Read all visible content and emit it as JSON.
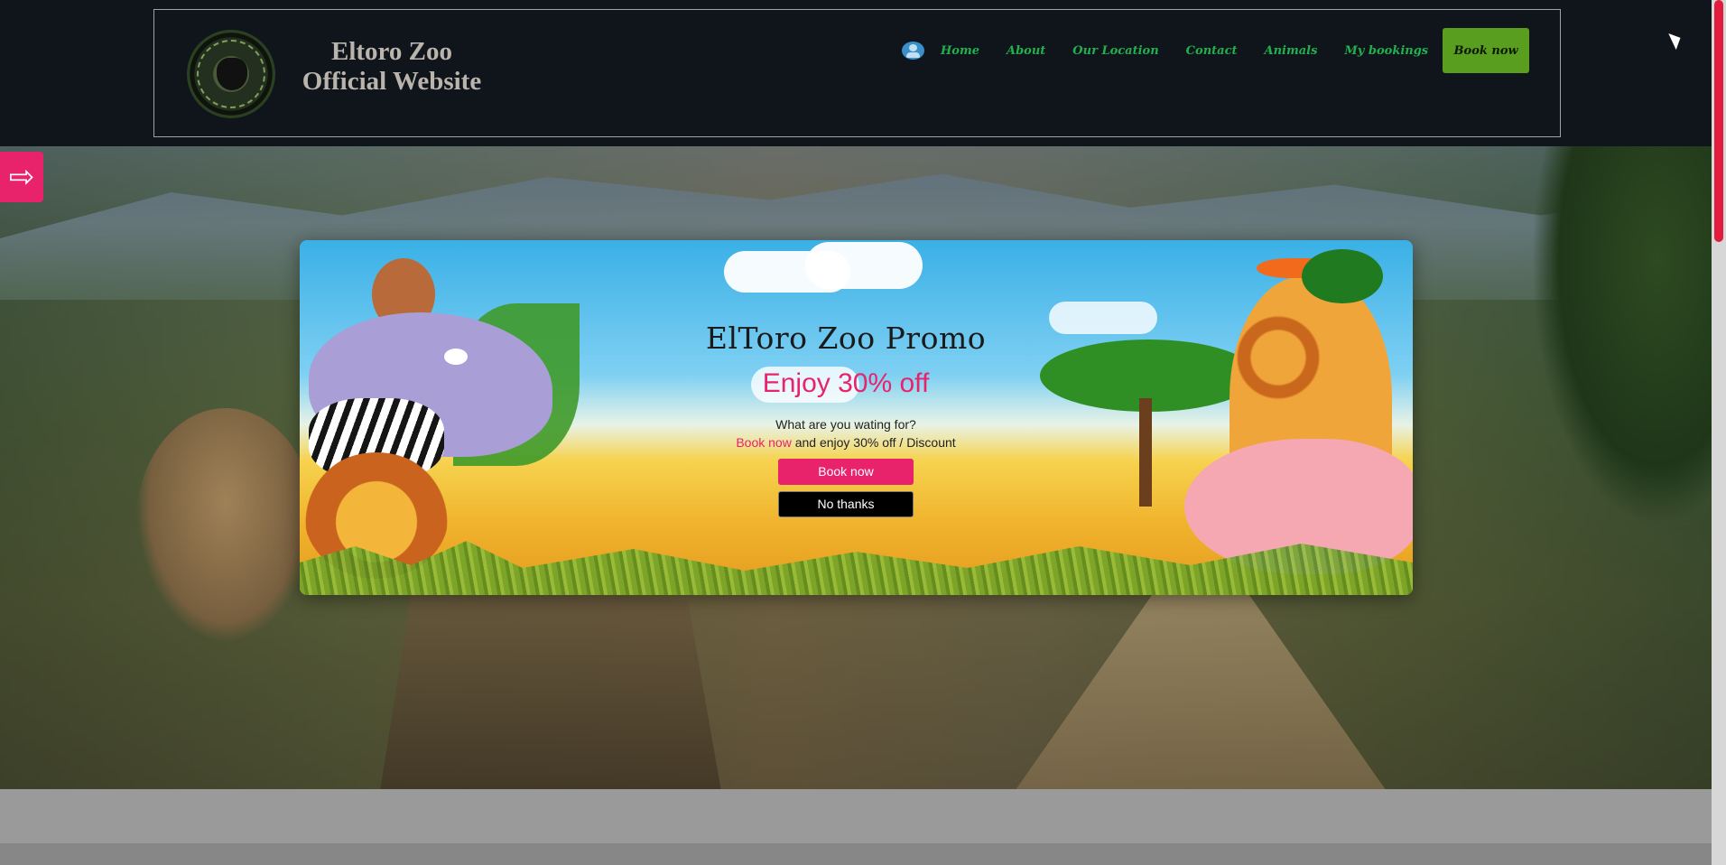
{
  "header": {
    "site_title_line1": "Eltoro Zoo",
    "site_title_line2": "Official Website",
    "logo_icon": "zoo-seal-logo",
    "user_icon": "user-icon",
    "nav": [
      {
        "label": "Home"
      },
      {
        "label": "About"
      },
      {
        "label": "Our Location"
      },
      {
        "label": "Contact"
      },
      {
        "label": "Animals"
      },
      {
        "label": "My bookings"
      }
    ],
    "book_button": "Book now"
  },
  "sidebar_toggle": {
    "icon": "arrow-right-icon",
    "glyph": "⇨"
  },
  "promo": {
    "title": "ElToro Zoo Promo",
    "subtitle": "Enjoy 30% off",
    "question": "What are you wating for?",
    "link_text": "Book now",
    "line_rest": " and enjoy 30% off / Discount",
    "book_button": "Book now",
    "dismiss_button": "No thanks"
  },
  "colors": {
    "accent_pink": "#e8236b",
    "nav_green": "#22b04e",
    "book_green": "#5a9e1f",
    "header_bg": "#10151c"
  }
}
